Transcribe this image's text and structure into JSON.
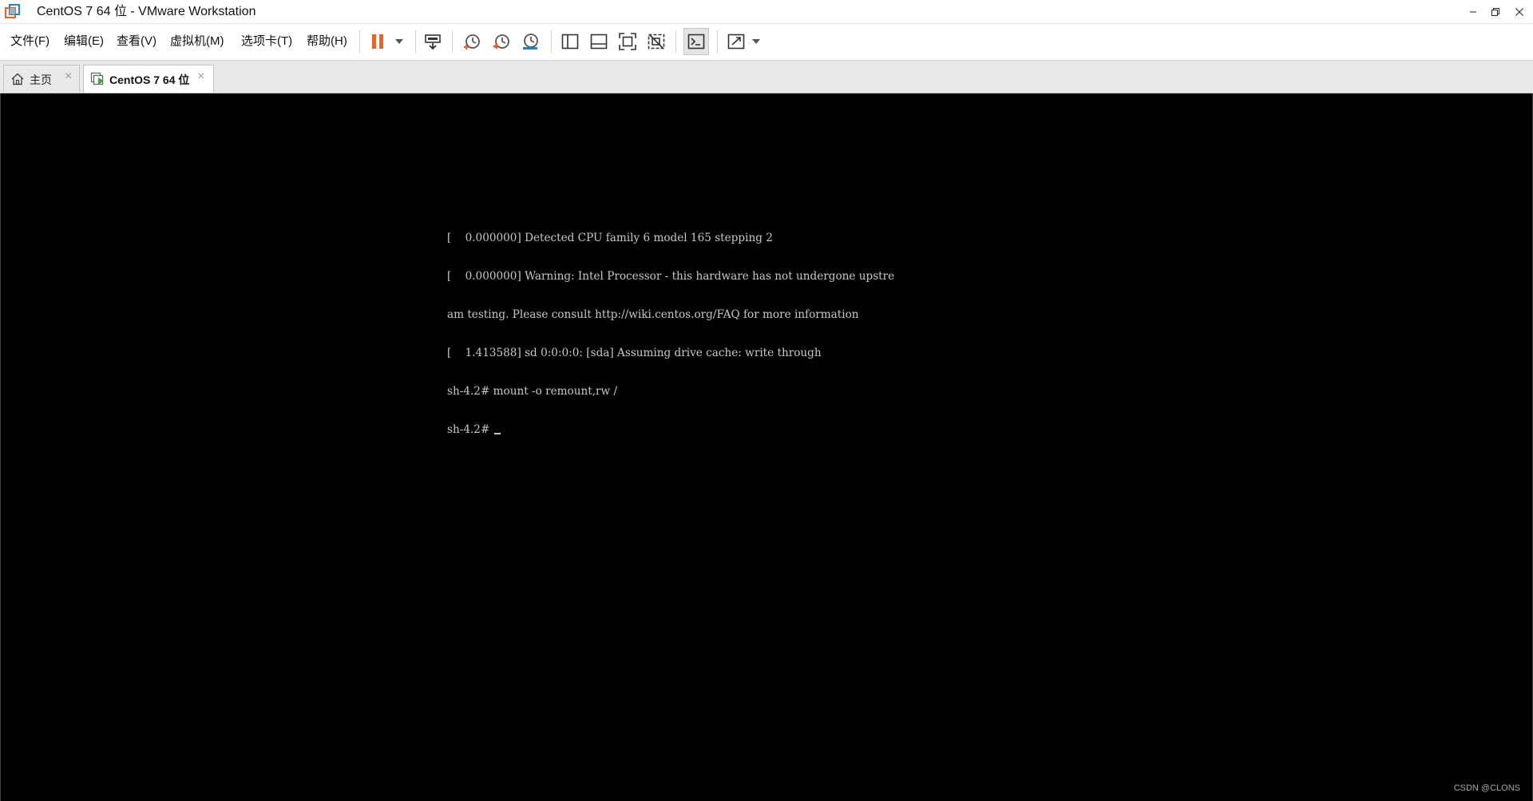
{
  "window": {
    "title": "CentOS 7 64 位 - VMware Workstation",
    "controls": [
      "minimize",
      "restore",
      "close"
    ]
  },
  "menu": [
    {
      "label": "文件(F)"
    },
    {
      "label": "编辑(E)"
    },
    {
      "label": "查看(V)"
    },
    {
      "label": "虚拟机(M)"
    },
    {
      "label": "选项卡(T)"
    },
    {
      "label": "帮助(H)"
    }
  ],
  "toolbar": {
    "icons": [
      "pause-icon",
      "dropdown-arrow-icon",
      "send-ctrl-alt-del-icon",
      "snapshot-take-icon",
      "snapshot-revert-icon",
      "snapshot-manager-icon",
      "show-library-icon",
      "thumbnail-bar-icon",
      "full-screen-icon",
      "unity-icon",
      "console-view-icon",
      "stretch-guest-icon",
      "dropdown-arrow-icon"
    ],
    "colors": {
      "pause": "#e8632a",
      "snapshot_take": "#e8632a",
      "snapshot_revert": "#e8632a",
      "snapshot_manager": "#2a7fc0"
    }
  },
  "tabs": [
    {
      "label": "主页",
      "icon": "home-icon",
      "active": false
    },
    {
      "label": "CentOS 7 64 位",
      "icon": "vm-running-icon",
      "active": true
    }
  ],
  "console": {
    "lines": [
      "[    0.000000] Detected CPU family 6 model 165 stepping 2",
      "[    0.000000] Warning: Intel Processor - this hardware has not undergone upstre",
      "am testing. Please consult http://wiki.centos.org/FAQ for more information",
      "[    1.413588] sd 0:0:0:0: [sda] Assuming drive cache: write through",
      "sh-4.2# mount -o remount,rw /",
      "sh-4.2# "
    ],
    "background": "#000000",
    "text_color": "#c8c8c8"
  },
  "watermark": "CSDN @CLONS"
}
